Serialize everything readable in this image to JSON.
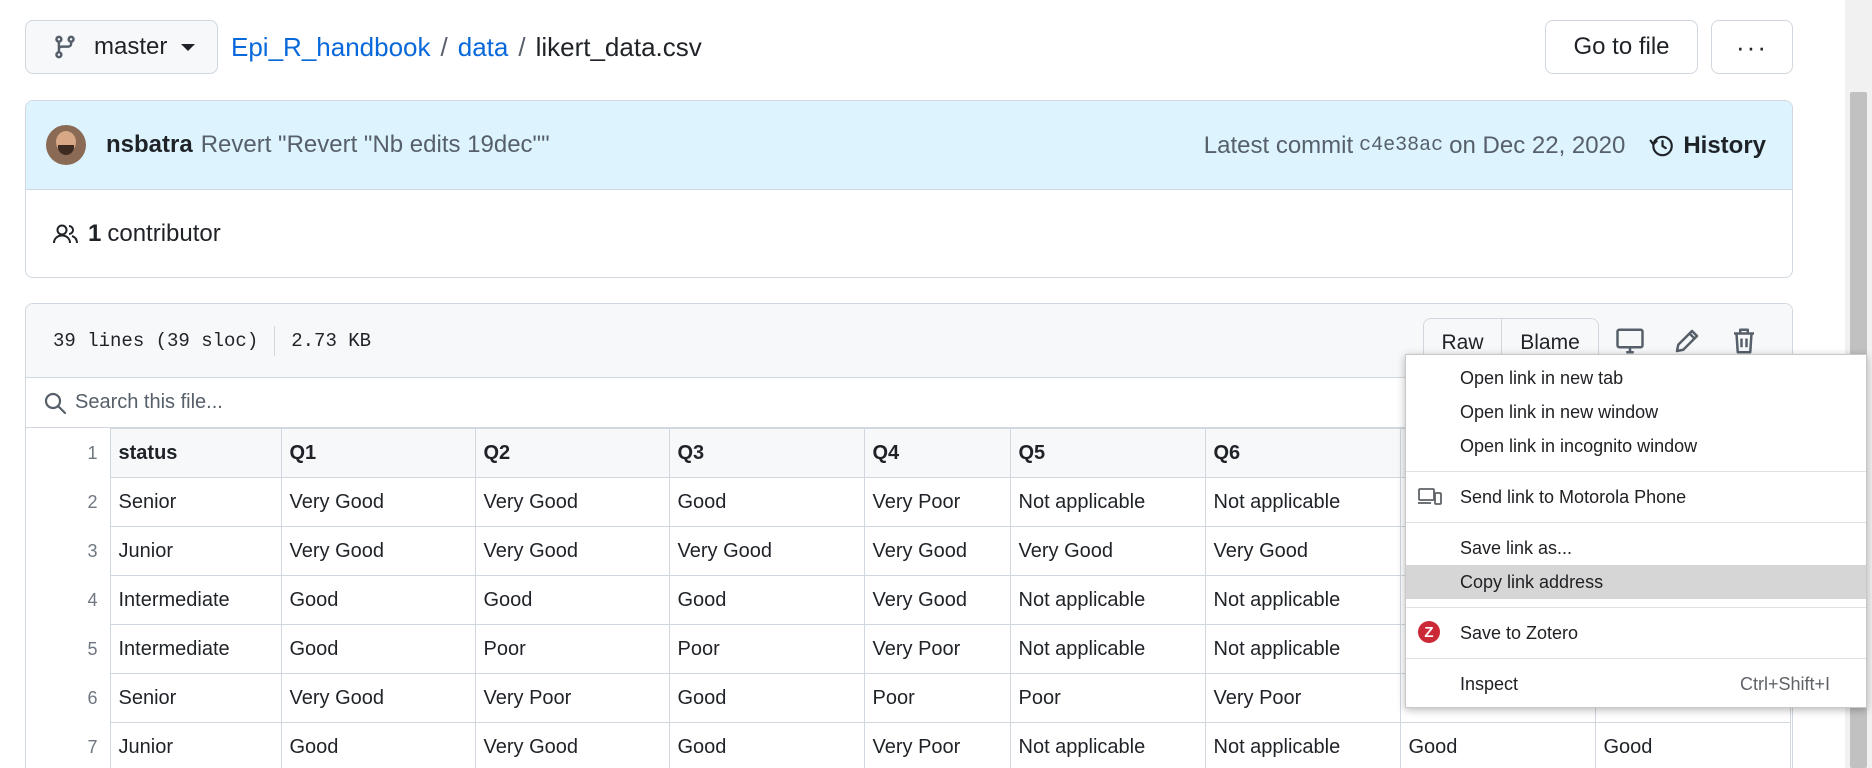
{
  "topbar": {
    "branch": "master",
    "breadcrumb": {
      "repo": "Epi_R_handbook",
      "sep": "/",
      "folder": "data",
      "file": "likert_data.csv"
    },
    "goto_label": "Go to file",
    "more_label": "···"
  },
  "commit": {
    "author": "nsbatra",
    "message": "Revert \"Revert \"Nb edits 19dec\"\"",
    "latest_label": "Latest commit",
    "sha": "c4e38ac",
    "date": "on Dec 22, 2020",
    "history_label": "History",
    "contributors_count": "1",
    "contributors_label": "contributor"
  },
  "file": {
    "lines": "39 lines (39 sloc)",
    "size": "2.73 KB",
    "raw_label": "Raw",
    "blame_label": "Blame",
    "search_placeholder": "Search this file..."
  },
  "table": {
    "header": [
      "status",
      "Q1",
      "Q2",
      "Q3",
      "Q4",
      "Q5",
      "Q6",
      "",
      ""
    ],
    "rows": [
      {
        "ln": "1"
      },
      {
        "ln": "2",
        "cells": [
          "Senior",
          "Very Good",
          "Very Good",
          "Good",
          "Very Poor",
          "Not applicable",
          "Not applicable",
          "",
          ""
        ]
      },
      {
        "ln": "3",
        "cells": [
          "Junior",
          "Very Good",
          "Very Good",
          "Very Good",
          "Very Good",
          "Very Good",
          "Very Good",
          "",
          ""
        ]
      },
      {
        "ln": "4",
        "cells": [
          "Intermediate",
          "Good",
          "Good",
          "Good",
          "Very Good",
          "Not applicable",
          "Not applicable",
          "",
          ""
        ]
      },
      {
        "ln": "5",
        "cells": [
          "Intermediate",
          "Good",
          "Poor",
          "Poor",
          "Very Poor",
          "Not applicable",
          "Not applicable",
          "",
          ""
        ]
      },
      {
        "ln": "6",
        "cells": [
          "Senior",
          "Very Good",
          "Very Poor",
          "Good",
          "Poor",
          "Poor",
          "Very Poor",
          "",
          ""
        ]
      },
      {
        "ln": "7",
        "cells": [
          "Junior",
          "Good",
          "Very Good",
          "Good",
          "Very Poor",
          "Not applicable",
          "Not applicable",
          "Good",
          "Good"
        ]
      }
    ]
  },
  "context_menu": {
    "items": [
      {
        "label": "Open link in new tab"
      },
      {
        "label": "Open link in new window"
      },
      {
        "label": "Open link in incognito window"
      },
      {
        "label": "Send link to Motorola Phone",
        "icon": "devices-icon"
      },
      {
        "label": "Save link as..."
      },
      {
        "label": "Copy link address",
        "highlighted": true
      },
      {
        "label": "Save to Zotero",
        "icon": "zotero-icon",
        "icon_text": "Z"
      },
      {
        "label": "Inspect",
        "shortcut": "Ctrl+Shift+I"
      }
    ]
  },
  "colors": {
    "link": "#0969da",
    "commit_bg": "#ddf4ff",
    "header_bg": "#f6f8fa",
    "border": "#d0d7de",
    "menu_highlight": "#d6d6d6"
  }
}
